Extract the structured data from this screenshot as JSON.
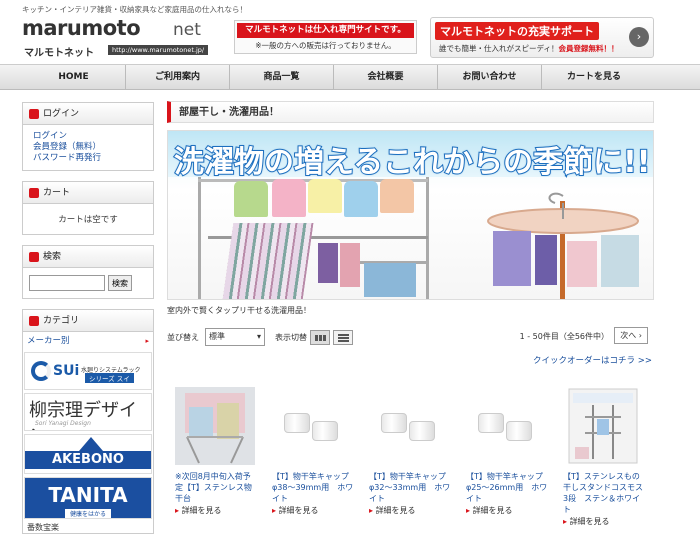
{
  "header": {
    "tagline": "キッチン・インテリア雑貨・収納家具など家庭用品の仕入れなら！",
    "logo_word": "marumoto",
    "logo_net": "net",
    "logo_kana": "マルモトネット",
    "logo_url": "http://www.marumotonet.jp/",
    "notice_title": "マルモトネットは仕入れ専門サイトです。",
    "notice_sub": "※一般の方への販売は行っておりません。",
    "support_title": "マルモトネットの充実サポート",
    "support_sub_plain": "誰でも簡単・仕入れがスピーディ！",
    "support_sub_bold": "会員登録無料！！",
    "support_arrow": "›"
  },
  "nav": {
    "items": [
      "HOME",
      "ご利用案内",
      "商品一覧",
      "会社概要",
      "お問い合わせ",
      "カートを見る"
    ]
  },
  "sidebar": {
    "login_title": "ログイン",
    "login_links": [
      "ログイン",
      "会員登録（無料）",
      "パスワード再発行"
    ],
    "cart_title": "カート",
    "cart_empty": "カートは空です",
    "search_title": "検索",
    "search_button": "検索",
    "category_title": "カテゴリ",
    "maker_label": "メーカー別",
    "maker_arrow": "▸",
    "brands": {
      "sui_name": "SUi",
      "sui_desc": "水廻りシステムラック",
      "sui_tag": "シリーズ スイ",
      "yana_name": "柳宗理デザイン",
      "yana_sub": "Sori Yanagi Design",
      "ake_name": "AKEBONO",
      "tan_name": "TANITA",
      "tan_sub": "健康をはかる"
    },
    "more": "番数宝楽"
  },
  "main": {
    "page_title": "部屋干し・洗濯用品！",
    "banner_text": "洗濯物の増えるこれからの季節に!!",
    "description": "室内外で賢くタップリ干せる洗濯用品！",
    "sort_label": "並び替え",
    "sort_value": "標準",
    "view_label": "表示切替",
    "count": "1 - 50件目（全56件中）",
    "next": "次へ ›",
    "quick_order": "クイックオーダーはコチラ >>",
    "more_label": "詳細を見る",
    "products": [
      {
        "name": "※次回8月中旬入荷予定【T】ステンレス物干台"
      },
      {
        "name": "【T】物干竿キャップ　φ38～39mm用　ホワイト"
      },
      {
        "name": "【T】物干竿キャップ　φ32～33mm用　ホワイト"
      },
      {
        "name": "【T】物干竿キャップ　φ25～26mm用　ホワイト"
      },
      {
        "name": "【T】ステンレスもの干しスタンドコスモス3段　ステン＆ホワイト"
      }
    ]
  },
  "colors": {
    "accent": "#d9141b",
    "link": "#1a4f9c",
    "brand_blue": "#1b4fa0"
  }
}
